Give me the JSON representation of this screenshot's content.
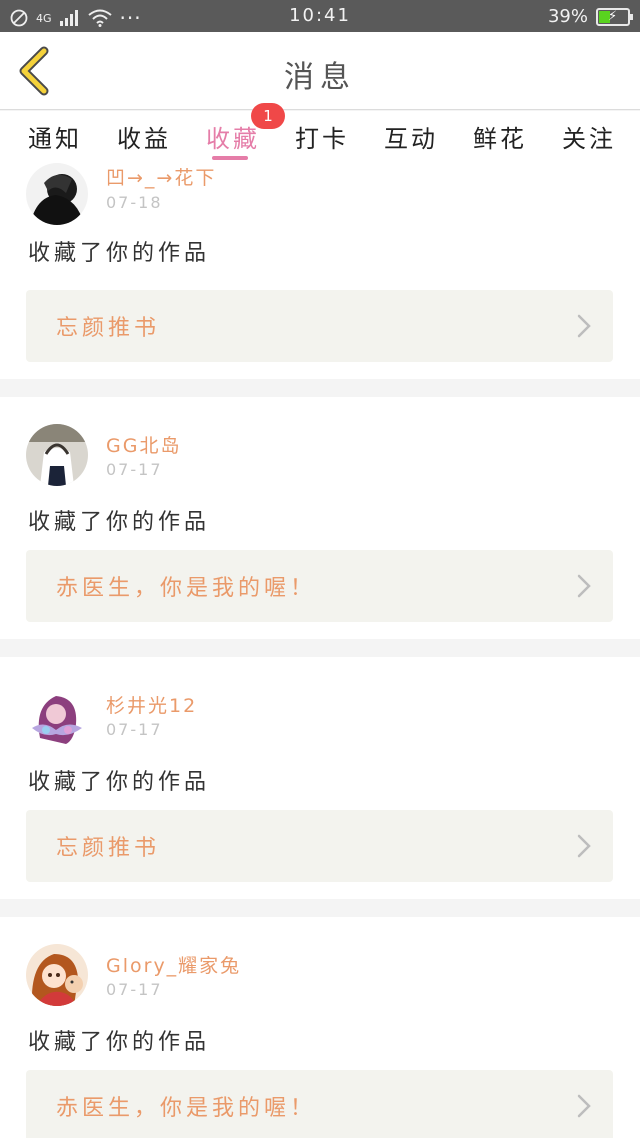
{
  "status_bar": {
    "time": "10:41",
    "network": "4G",
    "battery_percent": "39%",
    "battery_level": 0.39,
    "dots": "···"
  },
  "header": {
    "title": "消息",
    "back_icon": "chevron-left-icon"
  },
  "tabs": [
    {
      "label": "通知"
    },
    {
      "label": "收益"
    },
    {
      "label": "收藏",
      "badge": "1"
    },
    {
      "label": "打卡"
    },
    {
      "label": "互动"
    },
    {
      "label": "鲜花"
    },
    {
      "label": "关注"
    }
  ],
  "colors": {
    "accent_pink": "#e57da8",
    "username_orange": "#ea9a6a",
    "badge_red": "#f04848",
    "status_bar": "#5a5a5a"
  },
  "items": [
    {
      "user": "凹→_→花下",
      "date": "07-18",
      "action": "收藏了你的作品",
      "work": "忘颜推书"
    },
    {
      "user": "GG北岛",
      "date": "07-17",
      "action": "收藏了你的作品",
      "work": "赤医生，你是我的喔！"
    },
    {
      "user": "杉井光12",
      "date": "07-17",
      "action": "收藏了你的作品",
      "work": "忘颜推书"
    },
    {
      "user": "Glory_耀家兔",
      "date": "07-17",
      "action": "收藏了你的作品",
      "work": "赤医生，你是我的喔！"
    }
  ]
}
